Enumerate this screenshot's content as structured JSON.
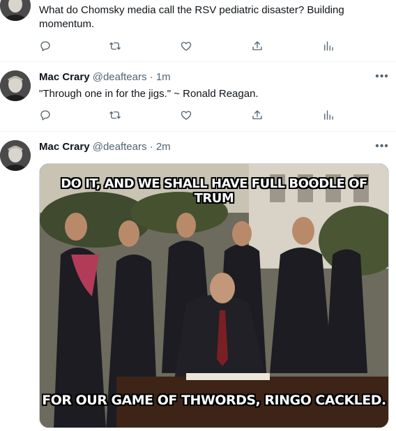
{
  "tweets": [
    {
      "name": "",
      "handle": "",
      "time": "",
      "text": "What do Chomsky media call the RSV pediatric disaster?  Building momentum."
    },
    {
      "name": "Mac Crary",
      "handle": "@deaftears",
      "time": "1m",
      "text": "\"Through one in for the jigs.\"  ~ Ronald Reagan."
    },
    {
      "name": "Mac Crary",
      "handle": "@deaftears",
      "time": "2m",
      "text": "",
      "media": {
        "caption_top": "DO IT, AND WE SHALL HAVE FULL BOODLE OF TRUM",
        "caption_bottom": "FOR OUR GAME OF THWORDS, RINGO CACKLED."
      }
    }
  ],
  "icons": {
    "reply": "reply-icon",
    "retweet": "retweet-icon",
    "like": "like-icon",
    "share": "share-icon",
    "analytics": "analytics-icon",
    "more": "more-icon"
  },
  "more_glyph": "•••",
  "separator": " · "
}
